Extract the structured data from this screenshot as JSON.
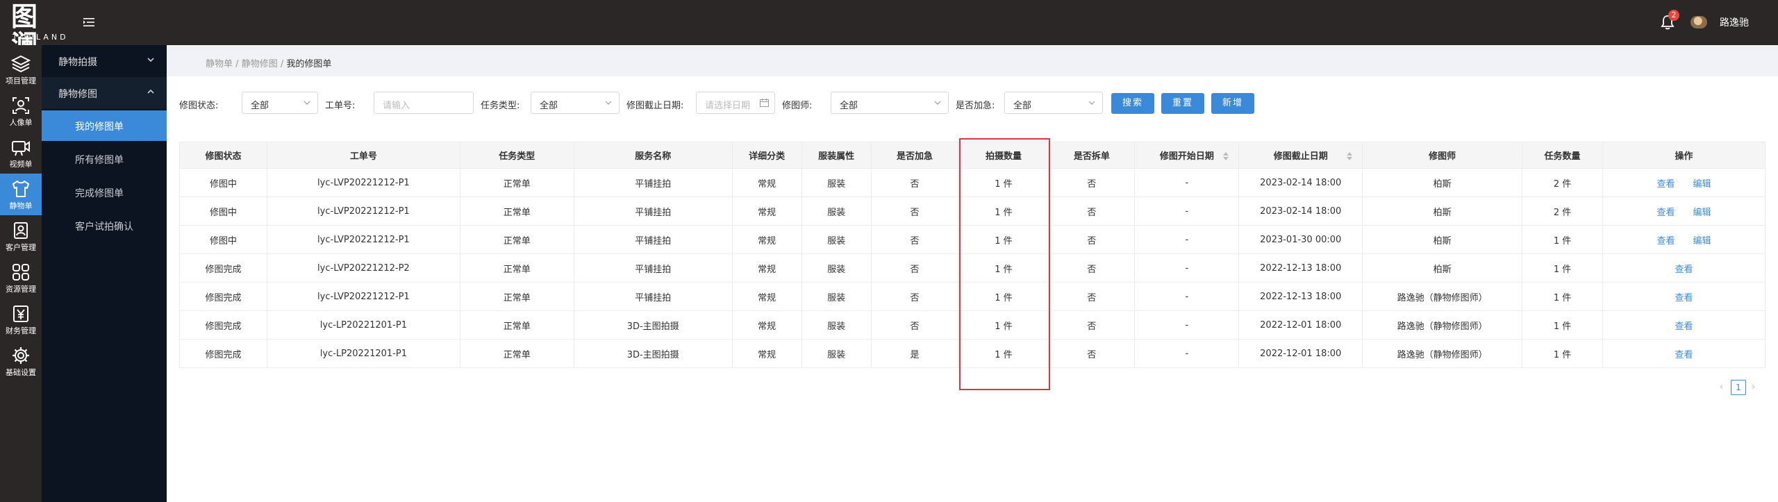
{
  "app": {
    "logo_cn": "图澜",
    "logo_en": "TOPLAND",
    "notification_count": "2",
    "user_name": "路逸驰"
  },
  "rail": [
    {
      "label": "项目管理",
      "icon": "layers-icon"
    },
    {
      "label": "人像单",
      "icon": "portrait-icon"
    },
    {
      "label": "视频单",
      "icon": "video-icon"
    },
    {
      "label": "静物单",
      "icon": "tshirt-icon"
    },
    {
      "label": "客户管理",
      "icon": "customer-icon"
    },
    {
      "label": "资源管理",
      "icon": "grid-icon"
    },
    {
      "label": "财务管理",
      "icon": "yen-icon"
    },
    {
      "label": "基础设置",
      "icon": "settings-icon"
    }
  ],
  "submenu": {
    "group1": "静物拍摄",
    "group2": "静物修图",
    "items": [
      "我的修图单",
      "所有修图单",
      "完成修图单",
      "客户试拍确认"
    ]
  },
  "breadcrumb": {
    "part1": "静物单",
    "part2": "静物修图",
    "current": "我的修图单",
    "sep": "/"
  },
  "filters": {
    "status_label": "修图状态:",
    "status_value": "全部",
    "order_label": "工单号:",
    "order_placeholder": "请输入",
    "task_type_label": "任务类型:",
    "task_type_value": "全部",
    "deadline_label": "修图截止日期:",
    "deadline_placeholder": "请选择日期",
    "retoucher_label": "修图师:",
    "retoucher_value": "全部",
    "urgent_label": "是否加急:",
    "urgent_value": "全部",
    "search_btn": "搜索",
    "reset_btn": "重置",
    "add_btn": "新增"
  },
  "table": {
    "headers": [
      "修图状态",
      "工单号",
      "任务类型",
      "服务名称",
      "详细分类",
      "服装属性",
      "是否加急",
      "拍摄数量",
      "是否拆单",
      "修图开始日期",
      "修图截止日期",
      "修图师",
      "任务数量",
      "操作"
    ],
    "rows": [
      [
        "修图中",
        "lyc-LVP20221212-P1",
        "正常单",
        "平铺挂拍",
        "常规",
        "服装",
        "否",
        "1 件",
        "否",
        "-",
        "2023-02-14 18:00",
        "柏斯",
        "2 件"
      ],
      [
        "修图中",
        "lyc-LVP20221212-P1",
        "正常单",
        "平铺挂拍",
        "常规",
        "服装",
        "否",
        "1 件",
        "否",
        "-",
        "2023-02-14 18:00",
        "柏斯",
        "2 件"
      ],
      [
        "修图中",
        "lyc-LVP20221212-P1",
        "正常单",
        "平铺挂拍",
        "常规",
        "服装",
        "否",
        "1 件",
        "否",
        "-",
        "2023-01-30 00:00",
        "柏斯",
        "1 件"
      ],
      [
        "修图完成",
        "lyc-LVP20221212-P2",
        "正常单",
        "平铺挂拍",
        "常规",
        "服装",
        "否",
        "1 件",
        "否",
        "-",
        "2022-12-13 18:00",
        "柏斯",
        "1 件"
      ],
      [
        "修图完成",
        "lyc-LVP20221212-P1",
        "正常单",
        "平铺挂拍",
        "常规",
        "服装",
        "否",
        "1 件",
        "否",
        "-",
        "2022-12-13 18:00",
        "路逸驰（静物修图师）",
        "1 件"
      ],
      [
        "修图完成",
        "lyc-LP20221201-P1",
        "正常单",
        "3D-主图拍摄",
        "常规",
        "服装",
        "否",
        "1 件",
        "否",
        "-",
        "2022-12-01 18:00",
        "路逸驰（静物修图师）",
        "1 件"
      ],
      [
        "修图完成",
        "lyc-LP20221201-P1",
        "正常单",
        "3D-主图拍摄",
        "常规",
        "服装",
        "是",
        "1 件",
        "否",
        "-",
        "2022-12-01 18:00",
        "路逸驰（静物修图师）",
        "1 件"
      ]
    ],
    "actions": [
      [
        "查看",
        "编辑"
      ],
      [
        "查看",
        "编辑"
      ],
      [
        "查看",
        "编辑"
      ],
      [
        "查看"
      ],
      [
        "查看"
      ],
      [
        "查看"
      ],
      [
        "查看"
      ]
    ]
  },
  "pager": {
    "prev": "‹",
    "current": "1",
    "next": "›"
  },
  "colors": {
    "primary": "#3b8ad9",
    "dark": "#2b2727",
    "highlight": "#d9363e"
  }
}
